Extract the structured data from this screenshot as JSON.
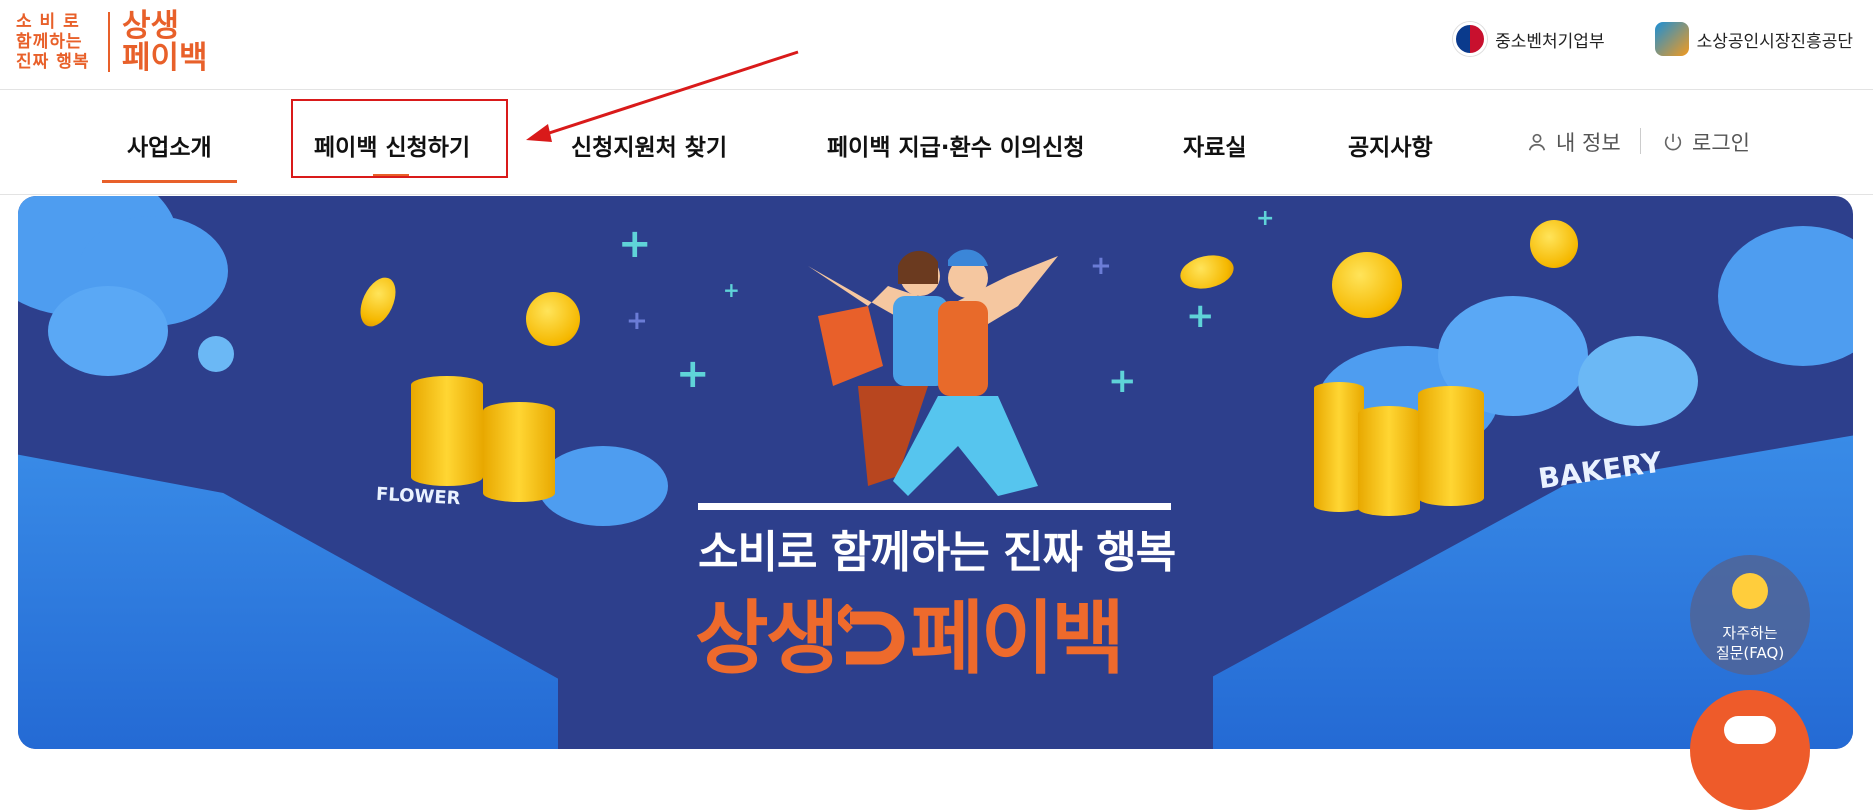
{
  "header": {
    "logo_small": "소 비 로\n함께하는\n진짜 행복",
    "logo_big": "상생\n페이백",
    "orgs": [
      {
        "label": "중소벤처기업부",
        "icon": "ministry-emblem-icon"
      },
      {
        "label": "소상공인시장진흥공단",
        "icon": "semas-logo-icon"
      }
    ]
  },
  "nav": {
    "items": [
      {
        "label": "사업소개"
      },
      {
        "label": "페이백 신청하기"
      },
      {
        "label": "신청지원처 찾기"
      },
      {
        "label": "페이백 지급·환수 이의신청"
      },
      {
        "label": "자료실"
      },
      {
        "label": "공지사항"
      }
    ],
    "my_info": "내 정보",
    "login": "로그인"
  },
  "banner": {
    "headline": "소비로 함께하는 진짜 행복",
    "brand": "상생",
    "brand_suffix": "페이백",
    "sign_flower": "FLOWER",
    "sign_bakery": "BAKERY"
  },
  "floating": {
    "faq_label": "자주하는\n질문(FAQ)"
  },
  "colors": {
    "accent": "#e8602a",
    "annotation": "#d91a1a",
    "banner_bg": "#2d3f8c"
  }
}
